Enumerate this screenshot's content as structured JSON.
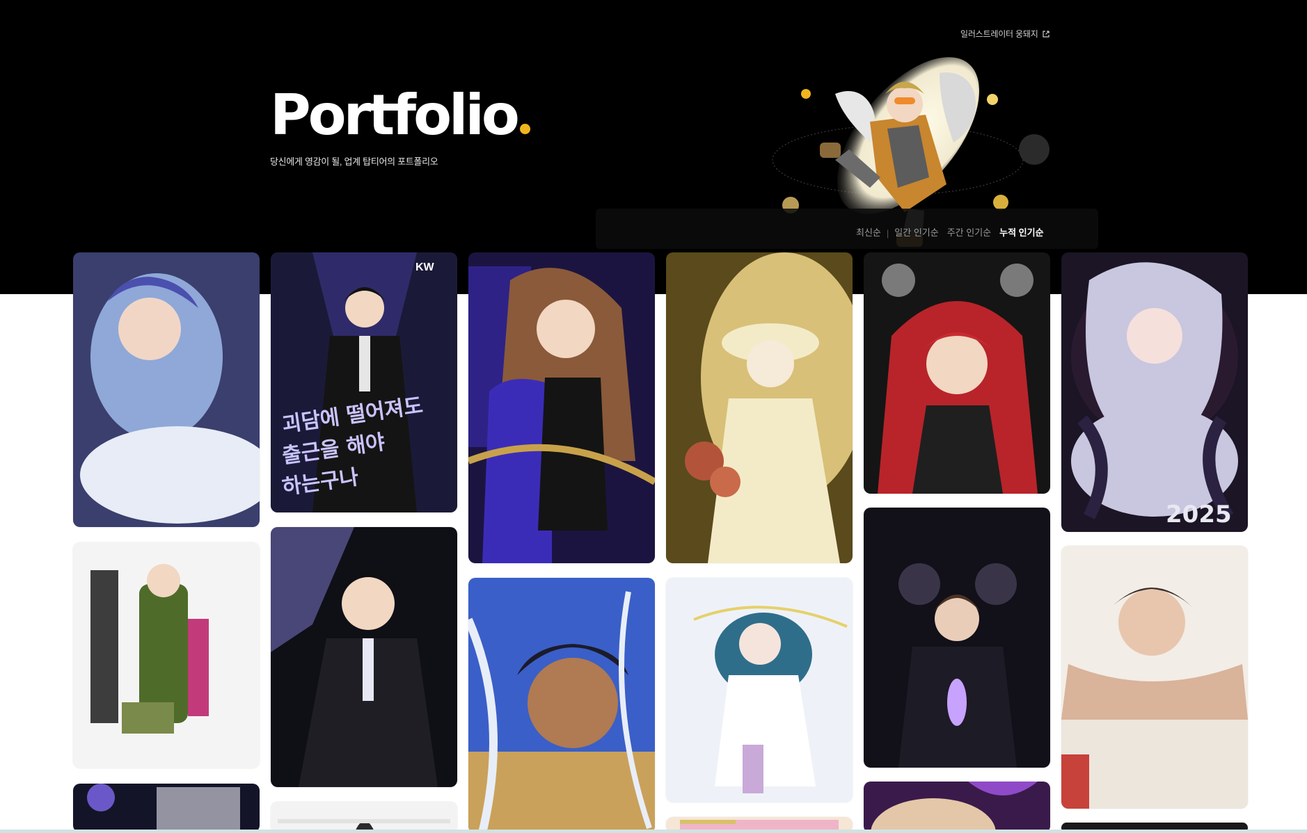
{
  "header": {
    "external_link": "일러스트레이터 웅돼지",
    "title": "Portfolio",
    "subtitle": "당신에게 영감이 될, 업계 탑티어의 포트폴리오"
  },
  "sort": {
    "options": [
      "최신순",
      "일간 인기순",
      "주간 인기순",
      "누적 인기순"
    ],
    "active": "누적 인기순"
  },
  "gallery": {
    "cards": [
      {
        "id": "c1",
        "palette": [
          "#3a3f6e",
          "#8fa8d8",
          "#e7ecf6"
        ]
      },
      {
        "id": "c2",
        "palette": [
          "#14142a",
          "#5a4cc8",
          "#c9c3ff"
        ],
        "badge": "KW",
        "caption": "괴담에 떨어져도 출근을 해야 하는구나"
      },
      {
        "id": "c3",
        "palette": [
          "#1c1440",
          "#3b2cb8",
          "#c8a24a"
        ]
      },
      {
        "id": "c4",
        "palette": [
          "#5a4a1c",
          "#d8c078",
          "#f3ebc7"
        ]
      },
      {
        "id": "c5",
        "palette": [
          "#151515",
          "#b8242a",
          "#7a7a7a"
        ]
      },
      {
        "id": "c6",
        "palette": [
          "#1b1525",
          "#c9c6df",
          "#d44a68"
        ],
        "caption": "2025"
      },
      {
        "id": "c7",
        "palette": [
          "#f4f4f4",
          "#4f6b2a",
          "#c23a7a"
        ]
      },
      {
        "id": "c8",
        "palette": [
          "#0f0f16",
          "#7a76c8",
          "#e8e8f4"
        ]
      },
      {
        "id": "c9",
        "palette": [
          "#3a5fc8",
          "#1b1b2b",
          "#e8eef8"
        ]
      },
      {
        "id": "c10",
        "palette": [
          "#eef2f8",
          "#2f6e8a",
          "#c9a9d8"
        ]
      },
      {
        "id": "c11",
        "palette": [
          "#121018",
          "#3a3448",
          "#c7a2ff"
        ]
      },
      {
        "id": "c12",
        "palette": [
          "#f2ede6",
          "#8a6a52",
          "#3a2f28"
        ]
      },
      {
        "id": "c13",
        "palette": [
          "#141428",
          "#6b58c8",
          "#e7e7f3"
        ]
      },
      {
        "id": "c14",
        "palette": [
          "#f3f3f3",
          "#9a7a6a",
          "#2b2b2b"
        ]
      },
      {
        "id": "c15",
        "palette": [
          "#f6e6d6",
          "#f0b4c8",
          "#d9c16a"
        ]
      },
      {
        "id": "c16",
        "palette": [
          "#3a1a4a",
          "#8f4ac8",
          "#e4c7a8"
        ]
      },
      {
        "id": "c17",
        "palette": [
          "#1a1a1a",
          "#2a2a2a",
          "#444444"
        ]
      }
    ]
  },
  "colors": {
    "accent_yellow": "#f0b51e",
    "hero_bg": "#000000",
    "page_bg": "#ffffff"
  },
  "icons": {
    "external_link": "external-link-icon",
    "mascot": "angel-mascot-illustration"
  }
}
